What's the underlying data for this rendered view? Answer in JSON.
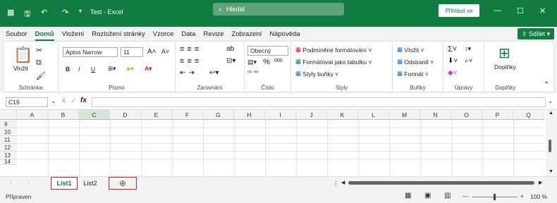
{
  "titlebar": {
    "doc_title": "Test - Excel",
    "search_placeholder": "Hledat",
    "login_label": "Přihlásit se"
  },
  "menu": {
    "items": [
      "Soubor",
      "Domů",
      "Vložení",
      "Rozložení stránky",
      "Vzorce",
      "Data",
      "Revize",
      "Zobrazení",
      "Nápověda"
    ],
    "share_label": "Sdílet"
  },
  "ribbon": {
    "clipboard": {
      "paste": "Vložit",
      "label": "Schránka"
    },
    "font": {
      "name": "Aptos Narrow",
      "size": "11",
      "label": "Písmo",
      "bold": "B",
      "italic": "I",
      "underline": "U"
    },
    "alignment": {
      "label": "Zarovnání"
    },
    "number": {
      "format": "Obecný",
      "label": "Číslo"
    },
    "styles": {
      "cond": "Podmíněné formátování",
      "table": "Formátovat jako tabulku",
      "cell": "Styly buňky",
      "label": "Styly"
    },
    "cells": {
      "insert": "Vložit",
      "delete": "Odstranit",
      "format": "Formát",
      "label": "Buňky"
    },
    "editing": {
      "label": "Úpravy"
    },
    "addins": {
      "btn": "Doplňky",
      "label": "Doplňky"
    }
  },
  "formula": {
    "namebox": "C19",
    "fx": "fx"
  },
  "grid": {
    "columns": [
      "A",
      "B",
      "C",
      "D",
      "E",
      "F",
      "G",
      "H",
      "I",
      "J",
      "K",
      "L",
      "M",
      "N",
      "O",
      "P",
      "Q"
    ],
    "rows": [
      "9",
      "10",
      "11",
      "12",
      "13",
      "14"
    ]
  },
  "sheets": {
    "tab1": "List1",
    "tab2": "List2"
  },
  "status": {
    "ready": "Připraven",
    "zoom": "100 %"
  }
}
